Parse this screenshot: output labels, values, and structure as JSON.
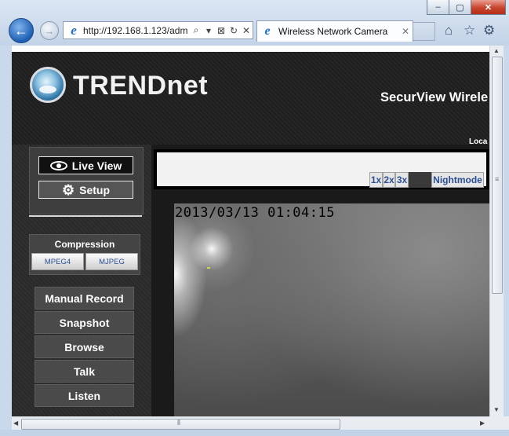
{
  "browser": {
    "address": "http://192.168.1.123/adm",
    "tab_title": "Wireless Network Camera",
    "window_buttons": [
      "–",
      "▢",
      "✕"
    ],
    "back_glyph": "←",
    "forward_glyph": "→",
    "tab_close": "✕",
    "toolbar_icons": [
      "home-icon",
      "favorites-star-icon",
      "tools-gear-icon"
    ]
  },
  "brand": {
    "logo_text": "TRENDnet",
    "product_title": "SecurView Wirele",
    "location_snippet": "Loca"
  },
  "nav": {
    "live_view": "Live View",
    "setup": "Setup"
  },
  "compression": {
    "title": "Compression",
    "options": [
      "MPEG4",
      "MJPEG"
    ]
  },
  "actions": [
    "Manual Record",
    "Snapshot",
    "Browse",
    "Talk",
    "Listen"
  ],
  "toolbar": {
    "zoom": [
      "1x",
      "2x",
      "3x"
    ],
    "nightmode": "Nightmode"
  },
  "video": {
    "timestamp": "2013/03/13 01:04:15"
  }
}
